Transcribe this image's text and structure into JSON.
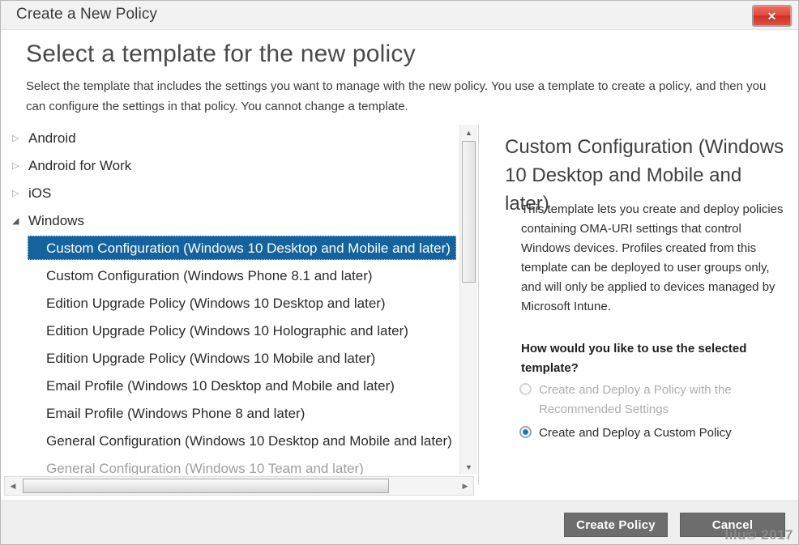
{
  "window": {
    "title": "Create a New Policy",
    "close_label": "✕",
    "close_icon": "close-icon"
  },
  "header": {
    "title": "Select a template for the new policy",
    "subtitle": "Select the template that includes the settings you want to manage with the new policy. You use a template to create a policy, and then you can configure the settings in that policy. You cannot change a template."
  },
  "tree": {
    "expander_collapsed": "▷",
    "expander_expanded": "◢",
    "nodes": [
      {
        "label": "Android",
        "level": 0,
        "expanded": false,
        "selected": false
      },
      {
        "label": "Android for Work",
        "level": 0,
        "expanded": false,
        "selected": false
      },
      {
        "label": "iOS",
        "level": 0,
        "expanded": false,
        "selected": false
      },
      {
        "label": "Windows",
        "level": 0,
        "expanded": true,
        "selected": false
      },
      {
        "label": "Custom Configuration (Windows 10 Desktop and Mobile and later)",
        "level": 1,
        "expanded": null,
        "selected": true
      },
      {
        "label": "Custom Configuration (Windows Phone 8.1 and later)",
        "level": 1,
        "expanded": null,
        "selected": false
      },
      {
        "label": "Edition Upgrade Policy (Windows 10 Desktop and later)",
        "level": 1,
        "expanded": null,
        "selected": false
      },
      {
        "label": "Edition Upgrade Policy (Windows 10 Holographic and later)",
        "level": 1,
        "expanded": null,
        "selected": false
      },
      {
        "label": "Edition Upgrade Policy (Windows 10 Mobile and later)",
        "level": 1,
        "expanded": null,
        "selected": false
      },
      {
        "label": "Email Profile (Windows 10 Desktop and Mobile and later)",
        "level": 1,
        "expanded": null,
        "selected": false
      },
      {
        "label": "Email Profile (Windows Phone 8 and later)",
        "level": 1,
        "expanded": null,
        "selected": false
      },
      {
        "label": "General Configuration (Windows 10 Desktop and Mobile and later)",
        "level": 1,
        "expanded": null,
        "selected": false
      },
      {
        "label": "General Configuration (Windows 10 Team and later)",
        "level": 1,
        "expanded": null,
        "selected": false
      }
    ]
  },
  "scrollbars": {
    "vertical_up": "▲",
    "vertical_down": "▼",
    "horizontal_left": "◀",
    "horizontal_right": "▶"
  },
  "detail": {
    "title": "Custom Configuration (Windows 10 Desktop and Mobile and later)",
    "body": "This template lets you create and deploy policies containing OMA-URI settings that control Windows devices. Profiles created from this template can be deployed to user groups only, and will only be applied to devices managed by Microsoft Intune.",
    "question": "How would you like to use the selected template?",
    "options": [
      {
        "label": "Create and Deploy a Policy with the Recommended Settings",
        "checked": false,
        "disabled": true
      },
      {
        "label": "Create and Deploy a Custom Policy",
        "checked": true,
        "disabled": false
      }
    ]
  },
  "footer": {
    "create_label": "Create Policy",
    "cancel_label": "Cancel"
  },
  "watermark": "lilu© 2017",
  "colors": {
    "selection_blue": "#14639e",
    "radio_blue": "#0a7fd4",
    "close_red": "#d9433a",
    "button_gray": "#6d6d6d"
  }
}
